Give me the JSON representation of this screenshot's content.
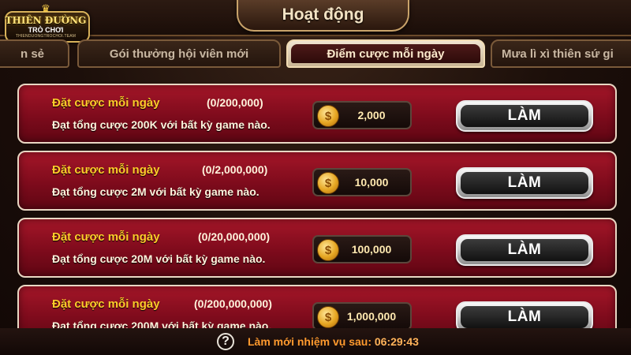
{
  "header": {
    "title": "Hoạt động",
    "logo": {
      "line1": "THIÊN ĐƯỜNG",
      "line2": "TRÒ CHƠI",
      "line3": "THIENDUONGTROCHOI.TEAM"
    }
  },
  "tabs": [
    {
      "label": "n sẻ",
      "active": false
    },
    {
      "label": "Gói thưởng hội viên mới",
      "active": false
    },
    {
      "label": "Điểm cược mỗi ngày",
      "active": true
    },
    {
      "label": "Mưa lì xì thiên sứ gi",
      "active": false
    }
  ],
  "tasks": [
    {
      "title": "Đặt cược mỗi ngày",
      "progress": "(0/200,000)",
      "description": "Đạt tổng cược 200K với bất kỳ game nào.",
      "reward": "2,000",
      "button": "LÀM"
    },
    {
      "title": "Đặt cược mỗi ngày",
      "progress": "(0/2,000,000)",
      "description": "Đạt tổng cược 2M với bất kỳ game nào.",
      "reward": "10,000",
      "button": "LÀM"
    },
    {
      "title": "Đặt cược mỗi ngày",
      "progress": "(0/20,000,000)",
      "description": "Đạt tổng cược 20M với bất kỳ game nào.",
      "reward": "100,000",
      "button": "LÀM"
    },
    {
      "title": "Đặt cược mỗi ngày",
      "progress": "(0/200,000,000)",
      "description": "Đạt tổng cược 200M với bất kỳ game nào.",
      "reward": "1,000,000",
      "button": "LÀM"
    }
  ],
  "footer": {
    "refresh_label": "Làm mới nhiệm vụ sau:",
    "refresh_time": "06:29:43"
  },
  "icons": {
    "coin": "dollar-coin-icon",
    "help": "question-mark-icon"
  },
  "colors": {
    "card_red": "#8e0f20",
    "title_gold": "#ffcc2a",
    "footer_orange": "#ff9a2e"
  }
}
